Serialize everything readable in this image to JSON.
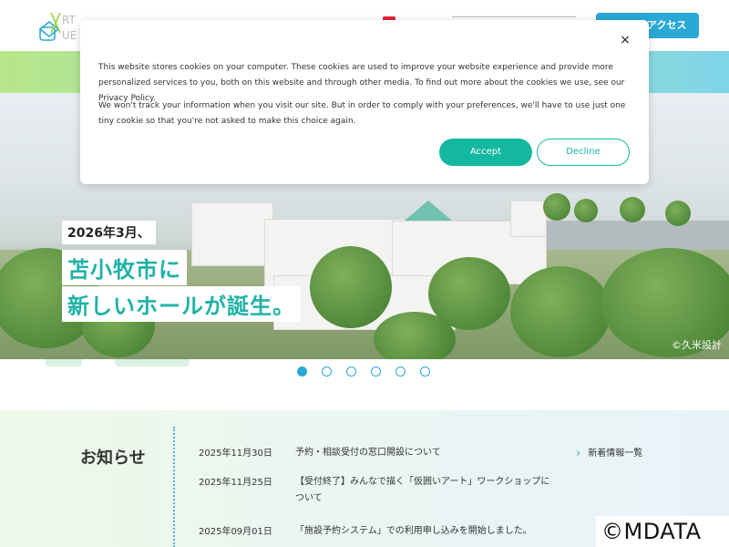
{
  "header": {
    "logo_text": "ART CUBE",
    "access_label": "アクセス"
  },
  "hero": {
    "line1": "2026年3月、",
    "line2": "苫小牧市に",
    "line3": "新しいホールが誕生。",
    "credit": "©久米設計",
    "slide_count": 6,
    "active_slide": 1
  },
  "cookie": {
    "text1": "This website stores cookies on your computer. These cookies are used to improve your website experience and provide more personalized services to you, both on this website and through other media. To find out more about the cookies we use, see our Privacy Policy.",
    "text2": "We won't track your information when you visit our site. But in order to comply with your preferences, we'll have to use just one tiny cookie so that you're not asked to make this choice again.",
    "accept_label": "Accept",
    "decline_label": "Decline",
    "close_icon": "×"
  },
  "news": {
    "heading": "お知らせ",
    "more_label": "新着情報一覧",
    "items": [
      {
        "date": "2025年11月30日",
        "title": "予約・相談受付の窓口開設について"
      },
      {
        "date": "2025年11月25日",
        "title": "【受付終了】みんなで描く「仮囲いアート」ワークショップについて"
      },
      {
        "date": "2025年09月01日",
        "title": "「施設予約システム」での利用申し込みを開始しました。"
      }
    ]
  },
  "watermark": "©MDATA",
  "colors": {
    "accent": "#2aa9d6",
    "teal": "#14b8a0",
    "hero_text": "#1fb3a6"
  }
}
